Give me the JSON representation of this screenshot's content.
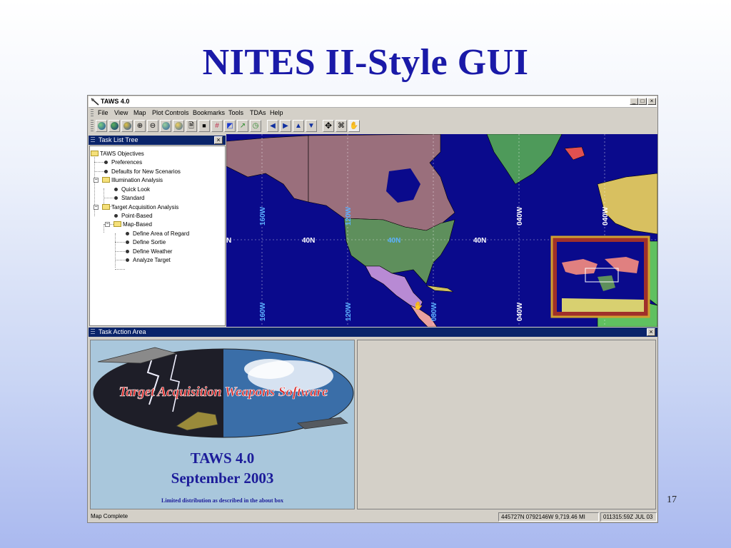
{
  "slide": {
    "title": "NITES II-Style GUI",
    "page_number": "17"
  },
  "window": {
    "title": "TAWS 4.0",
    "controls": {
      "minimize": "_",
      "maximize": "□",
      "close": "×"
    }
  },
  "menu": [
    "File",
    "View",
    "Map",
    "Plot Controls",
    "Bookmarks",
    "Tools",
    "TDAs",
    "Help"
  ],
  "toolbar_icons": [
    "globe-icon",
    "globe-icon",
    "globe-icon",
    "zoom-in-icon",
    "zoom-out-icon",
    "globe-icon",
    "globe-icon",
    "document-icon",
    "camera-icon",
    "grid-icon",
    "flag-icon",
    "line-icon",
    "clock-icon",
    "arrow-left-icon",
    "arrow-right-icon",
    "arrow-up-icon",
    "arrow-down-icon",
    "recenter-icon",
    "pan-icon",
    "hand-icon"
  ],
  "task_list": {
    "header": "Task List Tree",
    "items": [
      {
        "label": "TAWS Objectives"
      },
      {
        "label": "Preferences"
      },
      {
        "label": "Defaults for New Scenarios"
      },
      {
        "label": "Illumination Analysis"
      },
      {
        "label": "Quick Look"
      },
      {
        "label": "Standard"
      },
      {
        "label": "Target Acquisition Analysis"
      },
      {
        "label": "Point-Based"
      },
      {
        "label": "Map-Based"
      },
      {
        "label": "Define Area of Regard"
      },
      {
        "label": "Define Sortie"
      },
      {
        "label": "Define Weather"
      },
      {
        "label": "Analyze Target"
      }
    ]
  },
  "map": {
    "colors": {
      "ocean": "#0a0a8c",
      "alaska_canada": "#9a6f7c",
      "usa": "#5e8f5c",
      "mexico": "#b88ad4",
      "greenland": "#4e9a5a",
      "iceland": "#e05050"
    },
    "lat_labels": [
      "N",
      "40N",
      "40N",
      "40N"
    ],
    "lon_labels": [
      "160W",
      "120W",
      "040W",
      "040W",
      "160W",
      "120W",
      "080W",
      "040W"
    ]
  },
  "task_action": {
    "header": "Task Action Area",
    "splash": {
      "logo_text": "Target Acquisition Weapons Software",
      "version": "TAWS 4.0",
      "date": "September 2003",
      "note": "Limited distribution as described in the about box"
    }
  },
  "status": {
    "message": "Map Complete",
    "coords": "445727N 0792146W  9,719.46 MI",
    "time": "011315:59Z JUL 03"
  }
}
